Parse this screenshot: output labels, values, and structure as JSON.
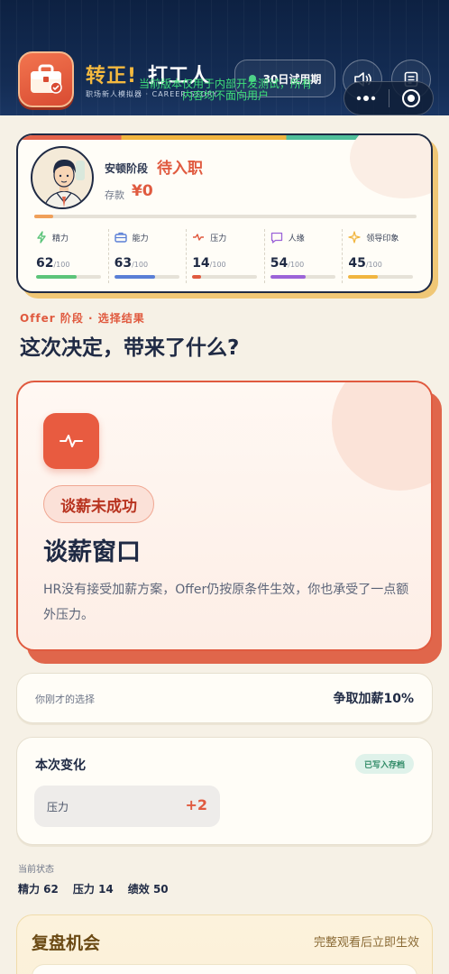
{
  "header": {
    "title_main": "转正!",
    "title_second": "打工人",
    "subtitle": "职场新人模拟器 · CAREER STORY",
    "dev_notice": "当前版本仅用于内部开发测试，所有内容均不面向用户",
    "trial_label": "30日试用期",
    "icons": [
      "sound-icon",
      "document-icon",
      "more-dots-icon",
      "target-icon"
    ]
  },
  "status": {
    "stage_label": "安顿阶段",
    "stage_value": "待入职",
    "savings_label": "存款",
    "savings_value": "¥0",
    "stage_progress": 0.05,
    "stats": [
      {
        "name": "精力",
        "value": "62",
        "max": "/100",
        "ratio": 0.62,
        "color": "#5cc47a",
        "icon": "energy-icon"
      },
      {
        "name": "能力",
        "value": "63",
        "max": "/100",
        "ratio": 0.63,
        "color": "#5a7fd6",
        "icon": "briefcase-icon"
      },
      {
        "name": "压力",
        "value": "14",
        "max": "/100",
        "ratio": 0.14,
        "color": "#e05a3f",
        "icon": "pulse-icon"
      },
      {
        "name": "人缘",
        "value": "54",
        "max": "/100",
        "ratio": 0.54,
        "color": "#9c64d8",
        "icon": "chat-icon"
      },
      {
        "name": "领导印象",
        "value": "45",
        "max": "/100",
        "ratio": 0.45,
        "color": "#f1b53f",
        "icon": "sparkle-icon"
      }
    ]
  },
  "section": {
    "eyebrow": "Offer 阶段 · 选择结果",
    "headline": "这次决定，带来了什么?"
  },
  "result": {
    "icon": "pulse-icon",
    "badge": "谈薪未成功",
    "title": "谈薪窗口",
    "description": "HR没有接受加薪方案，Offer仍按原条件生效，你也承受了一点额外压力。"
  },
  "choice": {
    "label": "你刚才的选择",
    "value": "争取加薪10%"
  },
  "changes": {
    "title": "本次变化",
    "saved_badge": "已写入存档",
    "items": [
      {
        "name": "压力",
        "delta": "+2"
      }
    ]
  },
  "current_state": {
    "label": "当前状态",
    "items": [
      "精力 62",
      "压力 14",
      "绩效 50"
    ]
  },
  "review": {
    "title": "复盘机会",
    "hint": "完整观看后立即生效"
  },
  "colors": {
    "header_bg": "#0d2142",
    "accent": "#e05a3f",
    "gold": "#f4b93f",
    "ink": "#1f2a44",
    "page_bg": "#f6f1e6"
  }
}
